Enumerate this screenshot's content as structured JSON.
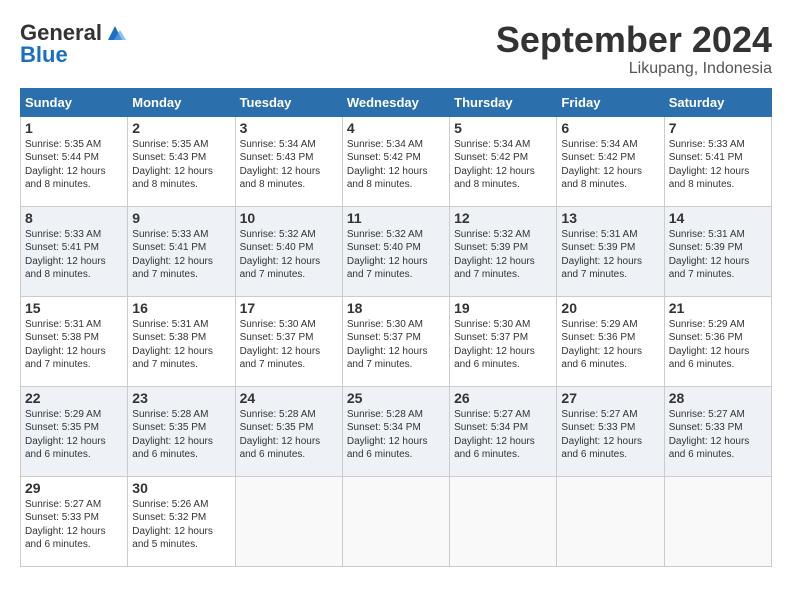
{
  "logo": {
    "line1": "General",
    "line2": "Blue"
  },
  "title": "September 2024",
  "location": "Likupang, Indonesia",
  "headers": [
    "Sunday",
    "Monday",
    "Tuesday",
    "Wednesday",
    "Thursday",
    "Friday",
    "Saturday"
  ],
  "weeks": [
    [
      {
        "day": "1",
        "text": "Sunrise: 5:35 AM\nSunset: 5:44 PM\nDaylight: 12 hours\nand 8 minutes."
      },
      {
        "day": "2",
        "text": "Sunrise: 5:35 AM\nSunset: 5:43 PM\nDaylight: 12 hours\nand 8 minutes."
      },
      {
        "day": "3",
        "text": "Sunrise: 5:34 AM\nSunset: 5:43 PM\nDaylight: 12 hours\nand 8 minutes."
      },
      {
        "day": "4",
        "text": "Sunrise: 5:34 AM\nSunset: 5:42 PM\nDaylight: 12 hours\nand 8 minutes."
      },
      {
        "day": "5",
        "text": "Sunrise: 5:34 AM\nSunset: 5:42 PM\nDaylight: 12 hours\nand 8 minutes."
      },
      {
        "day": "6",
        "text": "Sunrise: 5:34 AM\nSunset: 5:42 PM\nDaylight: 12 hours\nand 8 minutes."
      },
      {
        "day": "7",
        "text": "Sunrise: 5:33 AM\nSunset: 5:41 PM\nDaylight: 12 hours\nand 8 minutes."
      }
    ],
    [
      {
        "day": "8",
        "text": "Sunrise: 5:33 AM\nSunset: 5:41 PM\nDaylight: 12 hours\nand 8 minutes."
      },
      {
        "day": "9",
        "text": "Sunrise: 5:33 AM\nSunset: 5:41 PM\nDaylight: 12 hours\nand 7 minutes."
      },
      {
        "day": "10",
        "text": "Sunrise: 5:32 AM\nSunset: 5:40 PM\nDaylight: 12 hours\nand 7 minutes."
      },
      {
        "day": "11",
        "text": "Sunrise: 5:32 AM\nSunset: 5:40 PM\nDaylight: 12 hours\nand 7 minutes."
      },
      {
        "day": "12",
        "text": "Sunrise: 5:32 AM\nSunset: 5:39 PM\nDaylight: 12 hours\nand 7 minutes."
      },
      {
        "day": "13",
        "text": "Sunrise: 5:31 AM\nSunset: 5:39 PM\nDaylight: 12 hours\nand 7 minutes."
      },
      {
        "day": "14",
        "text": "Sunrise: 5:31 AM\nSunset: 5:39 PM\nDaylight: 12 hours\nand 7 minutes."
      }
    ],
    [
      {
        "day": "15",
        "text": "Sunrise: 5:31 AM\nSunset: 5:38 PM\nDaylight: 12 hours\nand 7 minutes."
      },
      {
        "day": "16",
        "text": "Sunrise: 5:31 AM\nSunset: 5:38 PM\nDaylight: 12 hours\nand 7 minutes."
      },
      {
        "day": "17",
        "text": "Sunrise: 5:30 AM\nSunset: 5:37 PM\nDaylight: 12 hours\nand 7 minutes."
      },
      {
        "day": "18",
        "text": "Sunrise: 5:30 AM\nSunset: 5:37 PM\nDaylight: 12 hours\nand 7 minutes."
      },
      {
        "day": "19",
        "text": "Sunrise: 5:30 AM\nSunset: 5:37 PM\nDaylight: 12 hours\nand 6 minutes."
      },
      {
        "day": "20",
        "text": "Sunrise: 5:29 AM\nSunset: 5:36 PM\nDaylight: 12 hours\nand 6 minutes."
      },
      {
        "day": "21",
        "text": "Sunrise: 5:29 AM\nSunset: 5:36 PM\nDaylight: 12 hours\nand 6 minutes."
      }
    ],
    [
      {
        "day": "22",
        "text": "Sunrise: 5:29 AM\nSunset: 5:35 PM\nDaylight: 12 hours\nand 6 minutes."
      },
      {
        "day": "23",
        "text": "Sunrise: 5:28 AM\nSunset: 5:35 PM\nDaylight: 12 hours\nand 6 minutes."
      },
      {
        "day": "24",
        "text": "Sunrise: 5:28 AM\nSunset: 5:35 PM\nDaylight: 12 hours\nand 6 minutes."
      },
      {
        "day": "25",
        "text": "Sunrise: 5:28 AM\nSunset: 5:34 PM\nDaylight: 12 hours\nand 6 minutes."
      },
      {
        "day": "26",
        "text": "Sunrise: 5:27 AM\nSunset: 5:34 PM\nDaylight: 12 hours\nand 6 minutes."
      },
      {
        "day": "27",
        "text": "Sunrise: 5:27 AM\nSunset: 5:33 PM\nDaylight: 12 hours\nand 6 minutes."
      },
      {
        "day": "28",
        "text": "Sunrise: 5:27 AM\nSunset: 5:33 PM\nDaylight: 12 hours\nand 6 minutes."
      }
    ],
    [
      {
        "day": "29",
        "text": "Sunrise: 5:27 AM\nSunset: 5:33 PM\nDaylight: 12 hours\nand 6 minutes."
      },
      {
        "day": "30",
        "text": "Sunrise: 5:26 AM\nSunset: 5:32 PM\nDaylight: 12 hours\nand 5 minutes."
      },
      null,
      null,
      null,
      null,
      null
    ]
  ]
}
